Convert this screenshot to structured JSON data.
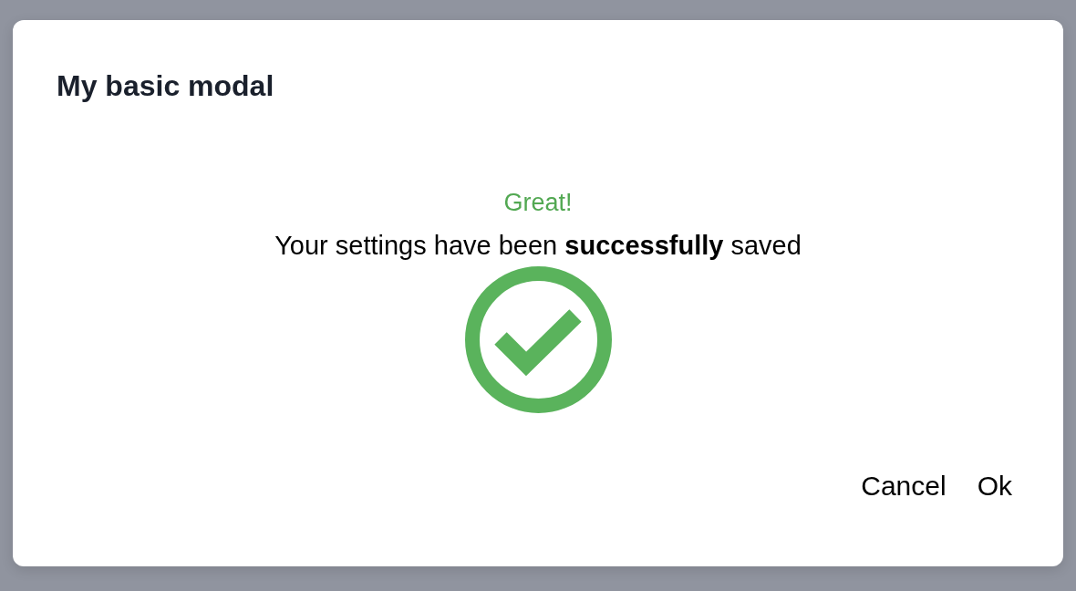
{
  "modal": {
    "title": "My basic modal",
    "status": {
      "kind": "success",
      "heading": "Great!",
      "message": "Your settings have been **successfully** saved"
    },
    "buttons": [
      "Cancel",
      "Ok"
    ]
  }
}
